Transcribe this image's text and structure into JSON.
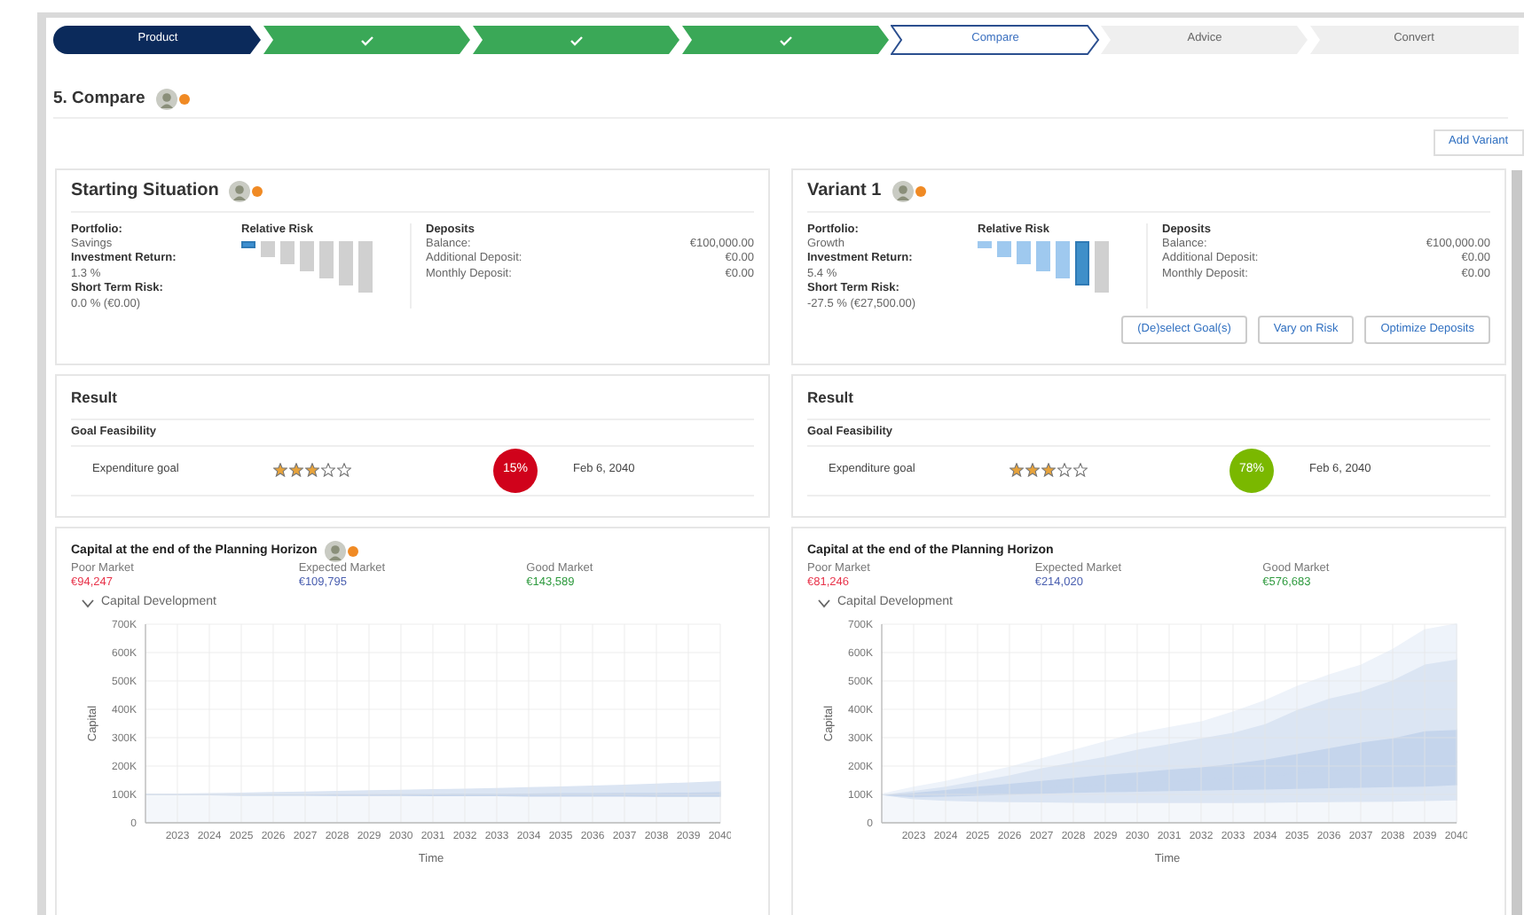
{
  "stepper": {
    "steps": [
      {
        "label": "Product",
        "kind": "header",
        "done": false,
        "selected": false
      },
      {
        "kind": "step",
        "done": true,
        "selected": false
      },
      {
        "kind": "step",
        "done": true,
        "selected": false
      },
      {
        "kind": "step",
        "done": true,
        "selected": false
      },
      {
        "label": "Compare",
        "kind": "step",
        "done": false,
        "selected": true
      },
      {
        "label": "Advice",
        "kind": "step",
        "done": false,
        "selected": false
      },
      {
        "label": "Convert",
        "kind": "step",
        "done": false,
        "selected": false
      }
    ]
  },
  "page_title": "5. Compare",
  "add_variant_button": "Add Variant",
  "scenarios": [
    {
      "title": "Starting Situation",
      "show_icons": true,
      "fields": [
        {
          "label": "Portfolio:",
          "value": "Savings"
        },
        {
          "label": "Investment Return:",
          "value": "1.3 %"
        },
        {
          "label": "Short Term Risk:",
          "value": "0.0 % (€0.00)"
        }
      ],
      "risk_title": "Relative Risk",
      "risk_bars": [
        {
          "selected": true
        },
        {
          "selected": false
        },
        {
          "selected": false
        },
        {
          "selected": false
        },
        {
          "selected": false
        },
        {
          "selected": false
        },
        {
          "selected": false
        }
      ],
      "deposits_title": "Deposits",
      "deposits": [
        {
          "label": "Balance:",
          "value": "€100,000.00"
        },
        {
          "label": "Additional Deposit:",
          "value": "€0.00"
        },
        {
          "label": "Monthly Deposit:",
          "value": "€0.00"
        }
      ],
      "result": {
        "title": "Result",
        "subtitle": "Goal Feasibility",
        "goals": [
          {
            "name": "Expenditure goal",
            "stars": 3,
            "percent": "15%",
            "color": "#d0021b",
            "date": "Feb 6, 2040"
          }
        ]
      },
      "capital": {
        "title": "Capital at the end of the Planning Horizon",
        "show_icons": true,
        "markets": [
          {
            "label": "Poor Market",
            "value": "€94,247",
            "color": "#e8334a"
          },
          {
            "label": "Expected Market",
            "value": "€109,795",
            "color": "#4a5fb0"
          },
          {
            "label": "Good Market",
            "value": "€143,589",
            "color": "#2e9a3e"
          }
        ],
        "toggle": {
          "label": "Capital Development",
          "expanded": true
        },
        "chart_data": {
          "type": "area",
          "stacked": true,
          "xlabel": "Time",
          "ylabel": "Capital",
          "grid": true,
          "x": [
            2022,
            2023,
            2024,
            2025,
            2026,
            2027,
            2028,
            2029,
            2030,
            2031,
            2032,
            2033,
            2034,
            2035,
            2036,
            2037,
            2038,
            2039,
            2040
          ],
          "xlim": [
            2022,
            2040
          ],
          "xticks": [
            2023,
            2024,
            2025,
            2026,
            2027,
            2028,
            2029,
            2030,
            2031,
            2032,
            2033,
            2034,
            2035,
            2036,
            2037,
            2038,
            2039,
            2040
          ],
          "ylim": [
            0,
            700000
          ],
          "yticks": [
            {
              "value": 0,
              "label": "0"
            },
            {
              "value": 100000,
              "label": "100K"
            },
            {
              "value": 200000,
              "label": "200K"
            },
            {
              "value": 300000,
              "label": "300K"
            },
            {
              "value": 400000,
              "label": "400K"
            },
            {
              "value": 500000,
              "label": "500K"
            },
            {
              "value": 600000,
              "label": "600K"
            },
            {
              "value": 700000,
              "label": "700K"
            }
          ],
          "series": [
            {
              "color": "#f4f7fb",
              "values": [
                100000,
                99000,
                99000,
                98000,
                98000,
                98000,
                97000,
                97000,
                97000,
                96000,
                96000,
                96000,
                95000,
                95000,
                95000,
                95000,
                94000,
                94000,
                94000
              ]
            },
            {
              "color": "#c5d5ec",
              "values": [
                0,
                1000,
                2000,
                3000,
                4000,
                4000,
                6000,
                6000,
                7000,
                8000,
                9000,
                9000,
                11000,
                12000,
                12000,
                13000,
                14000,
                15000,
                16000
              ]
            },
            {
              "color": "#dbe5f3",
              "values": [
                0,
                1000,
                1000,
                3000,
                4000,
                6000,
                7000,
                9000,
                10000,
                12000,
                13000,
                15000,
                17000,
                19000,
                22000,
                24000,
                28000,
                31000,
                34000
              ]
            }
          ]
        }
      }
    },
    {
      "title": "Variant 1",
      "show_icons": true,
      "fields": [
        {
          "label": "Portfolio:",
          "value": "Growth"
        },
        {
          "label": "Investment Return:",
          "value": "5.4 %"
        },
        {
          "label": "Short Term Risk:",
          "value": "-27.5 % (€27,500.00)"
        }
      ],
      "risk_title": "Relative Risk",
      "risk_bars": [
        {
          "selected": false
        },
        {
          "selected": false
        },
        {
          "selected": false
        },
        {
          "selected": false
        },
        {
          "selected": false
        },
        {
          "selected": true
        },
        {
          "selected": false
        }
      ],
      "deposits_title": "Deposits",
      "deposits": [
        {
          "label": "Balance:",
          "value": "€100,000.00"
        },
        {
          "label": "Additional Deposit:",
          "value": "€0.00"
        },
        {
          "label": "Monthly Deposit:",
          "value": "€0.00"
        }
      ],
      "buttons": [
        "(De)select Goal(s)",
        "Vary on Risk",
        "Optimize Deposits"
      ],
      "result": {
        "title": "Result",
        "subtitle": "Goal Feasibility",
        "goals": [
          {
            "name": "Expenditure goal",
            "stars": 3,
            "percent": "78%",
            "color": "#7ab800",
            "date": "Feb 6, 2040"
          }
        ]
      },
      "capital": {
        "title": "Capital at the end of the Planning Horizon",
        "show_icons": false,
        "markets": [
          {
            "label": "Poor Market",
            "value": "€81,246",
            "color": "#e8334a"
          },
          {
            "label": "Expected Market",
            "value": "€214,020",
            "color": "#4a5fb0"
          },
          {
            "label": "Good Market",
            "value": "€576,683",
            "color": "#2e9a3e"
          }
        ],
        "toggle": {
          "label": "Capital Development",
          "expanded": true
        },
        "chart_data": {
          "type": "area",
          "stacked": true,
          "xlabel": "Time",
          "ylabel": "Capital",
          "grid": true,
          "x": [
            2022,
            2023,
            2024,
            2025,
            2026,
            2027,
            2028,
            2029,
            2030,
            2031,
            2032,
            2033,
            2034,
            2035,
            2036,
            2037,
            2038,
            2039,
            2040
          ],
          "xlim": [
            2022,
            2040
          ],
          "xticks": [
            2023,
            2024,
            2025,
            2026,
            2027,
            2028,
            2029,
            2030,
            2031,
            2032,
            2033,
            2034,
            2035,
            2036,
            2037,
            2038,
            2039,
            2040
          ],
          "ylim": [
            0,
            700000
          ],
          "yticks": [
            {
              "value": 0,
              "label": "0"
            },
            {
              "value": 100000,
              "label": "100K"
            },
            {
              "value": 200000,
              "label": "200K"
            },
            {
              "value": 300000,
              "label": "300K"
            },
            {
              "value": 400000,
              "label": "400K"
            },
            {
              "value": 500000,
              "label": "500K"
            },
            {
              "value": 600000,
              "label": "600K"
            },
            {
              "value": 700000,
              "label": "700K"
            }
          ],
          "series": [
            {
              "color": "#f4f7fb",
              "values": [
                100000,
                85000,
                80000,
                77000,
                75000,
                74000,
                73000,
                72000,
                72000,
                72000,
                72000,
                72000,
                73000,
                74000,
                75000,
                76000,
                77000,
                79000,
                81000
              ]
            },
            {
              "color": "#dbe5f3",
              "values": [
                0,
                7000,
                15000,
                21000,
                27000,
                31000,
                35000,
                38000,
                40000,
                42000,
                44000,
                46000,
                47000,
                48000,
                49000,
                50000,
                51000,
                51000,
                54000
              ]
            },
            {
              "color": "#c5d5ec",
              "values": [
                0,
                10000,
                13000,
                15000,
                16000,
                19000,
                22000,
                26000,
                28000,
                32000,
                36000,
                40000,
                45000,
                53000,
                59000,
                66000,
                72000,
                80000,
                79000
              ]
            },
            {
              "color": "#c5d5ec",
              "values": [
                0,
                6000,
                10000,
                17000,
                22000,
                26000,
                30000,
                36000,
                40000,
                44000,
                46000,
                52000,
                60000,
                70000,
                82000,
                93000,
                100000,
                115000,
                116000
              ]
            },
            {
              "color": "#dbe5f3",
              "values": [
                0,
                7000,
                12000,
                20000,
                30000,
                45000,
                55000,
                63000,
                80000,
                90000,
                102000,
                110000,
                125000,
                155000,
                175000,
                180000,
                205000,
                235000,
                248000
              ]
            },
            {
              "color": "#eef3fa",
              "values": [
                0,
                10000,
                15000,
                20000,
                25000,
                30000,
                40000,
                50000,
                55000,
                55000,
                55000,
                70000,
                80000,
                80000,
                80000,
                90000,
                105000,
                120000,
                122000
              ]
            }
          ]
        }
      }
    }
  ]
}
